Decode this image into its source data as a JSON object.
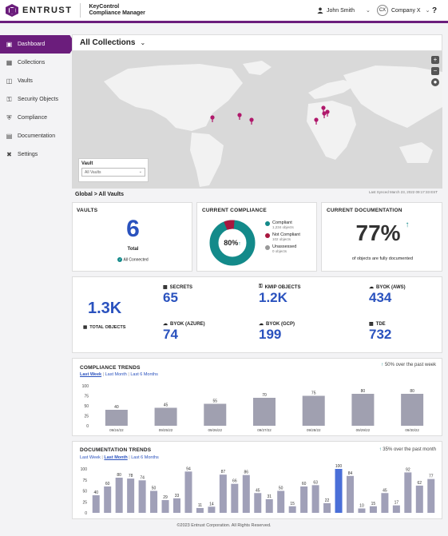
{
  "header": {
    "brand": "ENTRUST",
    "product_line1": "KeyControl",
    "product_line2": "Compliance Manager",
    "user_name": "John Smith",
    "company_initials": "CX",
    "company_name": "Company X",
    "help": "?"
  },
  "sidebar": {
    "items": [
      {
        "label": "Dashboard",
        "icon": "dashboard-icon"
      },
      {
        "label": "Collections",
        "icon": "collections-icon"
      },
      {
        "label": "Vaults",
        "icon": "vault-icon"
      },
      {
        "label": "Security Objects",
        "icon": "key-icon"
      },
      {
        "label": "Compliance",
        "icon": "shield-icon"
      },
      {
        "label": "Documentation",
        "icon": "document-icon"
      },
      {
        "label": "Settings",
        "icon": "settings-icon"
      }
    ]
  },
  "main": {
    "title": "All Collections",
    "map": {
      "vault_label": "Vault",
      "vault_select": "All Vaults",
      "synced": "Last Synced March 23, 2022 09:17:33 EST"
    },
    "breadcrumb": {
      "root": "Global",
      "sep": ">",
      "current": "All Vaults"
    }
  },
  "vaults_card": {
    "title": "VAULTS",
    "value": "6",
    "sub": "Total",
    "status": "All Connected"
  },
  "compliance_card": {
    "title": "CURRENT COMPLIANCE",
    "center": "80%",
    "legend": [
      {
        "label": "Compliant",
        "sub": "1,234 objects",
        "color": "#138a8a"
      },
      {
        "label": "Not Compliant",
        "sub": "102 objects",
        "color": "#a8173f"
      },
      {
        "label": "Unassessed",
        "sub": "0 objects",
        "color": "#999999"
      }
    ]
  },
  "documentation_card": {
    "title": "CURRENT DOCUMENTATION",
    "value": "77%",
    "sub": "of objects are fully documented"
  },
  "objects": {
    "total_value": "1.3K",
    "total_label": "TOTAL OBJECTS",
    "items": [
      {
        "label": "SECRETS",
        "value": "65"
      },
      {
        "label": "KMIP OBJECTS",
        "value": "1.2K"
      },
      {
        "label": "BYOK (AWS)",
        "value": "434"
      },
      {
        "label": "BYOK (AZURE)",
        "value": "74"
      },
      {
        "label": "BYOK (GCP)",
        "value": "199"
      },
      {
        "label": "TDE",
        "value": "732"
      }
    ]
  },
  "compliance_trends": {
    "title": "COMPLIANCE TRENDS",
    "tabs": [
      "Last Week",
      "Last Month",
      "Last 6 Months"
    ],
    "sep": "|",
    "note": "50% over the past week"
  },
  "documentation_trends": {
    "title": "DOCUMENTATION TRENDS",
    "tabs": [
      "Last Week",
      "Last Month",
      "Last 6 Months"
    ],
    "sep": "|",
    "note": "35% over the past month"
  },
  "chart_data": [
    {
      "type": "bar",
      "title": "COMPLIANCE TRENDS",
      "categories": [
        "09/24/22",
        "09/25/22",
        "09/26/22",
        "09/27/22",
        "09/28/22",
        "09/29/22",
        "09/30/22"
      ],
      "values": [
        40,
        45,
        55,
        70,
        75,
        80,
        80
      ],
      "ylim": [
        0,
        100
      ],
      "yticks": [
        0,
        25,
        50,
        75,
        100
      ]
    },
    {
      "type": "bar",
      "title": "DOCUMENTATION TRENDS",
      "values": [
        40,
        60,
        80,
        78,
        74,
        50,
        29,
        33,
        94,
        11,
        14,
        87,
        66,
        86,
        45,
        31,
        50,
        15,
        60,
        63,
        22,
        100,
        84,
        10,
        15,
        45,
        17,
        92,
        62,
        77
      ],
      "highlight_index": 21,
      "ylim": [
        0,
        100
      ],
      "yticks": [
        0,
        25,
        50,
        75,
        100
      ],
      "colors": {
        "bar": "#a0a0b8",
        "highlight": "#4a6fd8"
      }
    }
  ],
  "footer": "©2023 Entrust Corporation. All Rights Reserved."
}
